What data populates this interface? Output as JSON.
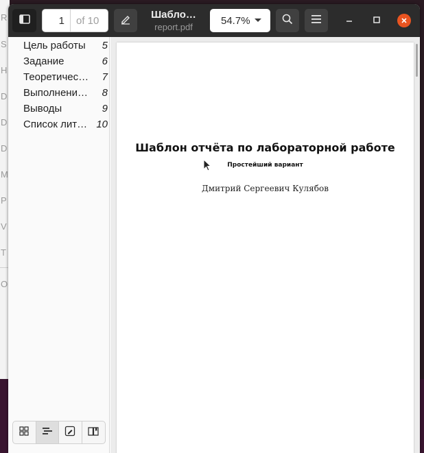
{
  "toolbar": {
    "page_current": "1",
    "page_of": "of 10",
    "title": "Шабло…",
    "filename": "report.pdf",
    "zoom": "54.7%"
  },
  "icons": {
    "sidebar_toggle": "sidebar-toggle-icon",
    "annotate": "pencil-icon",
    "search": "search-icon",
    "menu": "hamburger-menu-icon",
    "minimize": "minimize-icon",
    "maximize": "maximize-icon",
    "close": "close-icon"
  },
  "colors": {
    "accent_close": "#e95420",
    "titlebar": "#2c2c2c"
  },
  "toc": [
    {
      "label": "Цель работы",
      "page": "5"
    },
    {
      "label": "Задание",
      "page": "6"
    },
    {
      "label": "Теоретичес…",
      "page": "7"
    },
    {
      "label": "Выполнени…",
      "page": "8"
    },
    {
      "label": "Выводы",
      "page": "9"
    },
    {
      "label": "Список лит…",
      "page": "10"
    }
  ],
  "sidebar_tabs": [
    "thumbnails-icon",
    "outline-icon",
    "annotations-icon",
    "bookmarks-icon"
  ],
  "document": {
    "title": "Шаблон отчёта по лабораторной работе",
    "subtitle": "Простейший вариант",
    "author": "Дмитрий Сергеевич Кулябов"
  }
}
